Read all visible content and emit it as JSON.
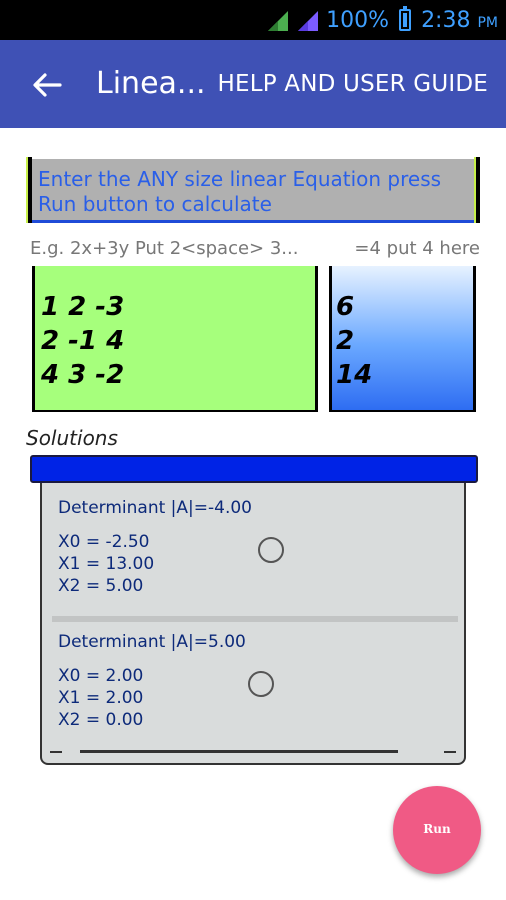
{
  "status_bar": {
    "battery": "100%",
    "time": "2:38",
    "time_suffix": "PM"
  },
  "app_bar": {
    "title": "Linea...",
    "help_label": "HELP AND USER GUIDE"
  },
  "instruction": {
    "text": "Enter the  ANY size linear Equation press Run button to calculate"
  },
  "hints": {
    "left": "E.g. 2x+3y Put 2<space> 3...",
    "right": "=4 put 4 here"
  },
  "matrix": {
    "rows": [
      "1 2 -3",
      "2 -1 4",
      "4 3 -2"
    ]
  },
  "rhs": {
    "rows": [
      "6",
      "2",
      "14"
    ]
  },
  "solutions": {
    "label": "Solutions",
    "items": [
      {
        "determinant": "Determinant |A|=-4.00",
        "x0": "X0 = -2.50",
        "x1": "X1 = 13.00",
        "x2": "X2 = 5.00"
      },
      {
        "determinant": "Determinant |A|=5.00",
        "x0": "X0 = 2.00",
        "x1": "X1 = 2.00",
        "x2": "X2 = 0.00"
      }
    ]
  },
  "fab": {
    "label": "Run"
  },
  "colors": {
    "app_bar": "#3f51b5",
    "matrix_bg": "#a6ff7c",
    "blue_bar": "#0023e6",
    "fab": "#f05a85"
  }
}
